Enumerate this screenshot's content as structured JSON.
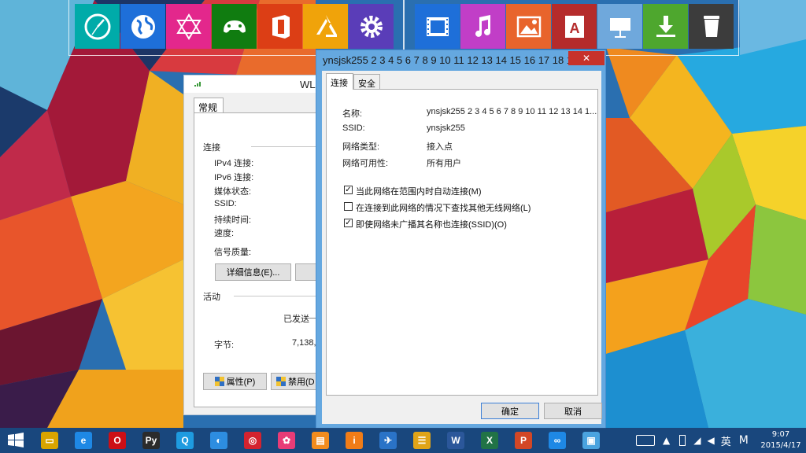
{
  "dock": {
    "left": [
      {
        "name": "clock-icon",
        "color": "#00aba9"
      },
      {
        "name": "globe-icon",
        "color": "#1e6fd9"
      },
      {
        "name": "network-icon",
        "color": "#e3278c"
      },
      {
        "name": "xbox-icon",
        "color": "#107c10"
      },
      {
        "name": "office-icon",
        "color": "#dc3e15"
      },
      {
        "name": "appstore-icon",
        "color": "#f0a30a"
      },
      {
        "name": "settings-icon",
        "color": "#5a3db8"
      }
    ],
    "right": [
      {
        "name": "video-icon",
        "color": "#1e6fd9"
      },
      {
        "name": "music-icon",
        "color": "#c13ec7"
      },
      {
        "name": "photos-icon",
        "color": "#e8642c"
      },
      {
        "name": "reader-icon",
        "color": "#b52b2b"
      },
      {
        "name": "keynote-icon",
        "color": "#6fa8dc"
      },
      {
        "name": "download-icon",
        "color": "#4ea72e"
      },
      {
        "name": "trash-icon",
        "color": "#3c3c3c"
      }
    ]
  },
  "wlan": {
    "title": "WLA",
    "tab": "常规",
    "section_connection": "连接",
    "ipv4": "IPv4 连接:",
    "ipv6": "IPv6 连接:",
    "media_state": "媒体状态:",
    "ssid": "SSID:",
    "duration": "持续时间:",
    "speed": "速度:",
    "signal": "信号质量:",
    "details_btn": "详细信息(E)...",
    "section_activity": "活动",
    "sent": "已发送",
    "bytes": "字节:",
    "bytes_value": "7,138,5",
    "properties_btn": "属性(P)",
    "disable_btn": "禁用(D"
  },
  "ssid_dialog": {
    "title": "ynsjsk255 2 3 4 5 6 7 8 9 10 11 12 13 14 15 16 17 18 19 ...",
    "close": "✕",
    "tab_connection": "连接",
    "tab_security": "安全",
    "name_label": "名称:",
    "name_value": "ynsjsk255 2 3 4 5 6 7 8 9 10 11 12 13 14 1...",
    "ssid_label": "SSID:",
    "ssid_value": "ynsjsk255",
    "type_label": "网络类型:",
    "type_value": "接入点",
    "avail_label": "网络可用性:",
    "avail_value": "所有用户",
    "opt1": "当此网络在范围内时自动连接(M)",
    "opt1_checked": true,
    "opt2": "在连接到此网络的情况下查找其他无线网络(L)",
    "opt2_checked": false,
    "opt3": "即使网络未广播其名称也连接(SSID)(O)",
    "opt3_checked": true,
    "ok": "确定",
    "cancel": "取消"
  },
  "taskbar": {
    "apps": [
      {
        "name": "file-explorer-icon",
        "color": "#d9a400",
        "glyph": "▭"
      },
      {
        "name": "internet-explorer-icon",
        "color": "#1e88e5",
        "glyph": "e"
      },
      {
        "name": "opera-icon",
        "color": "#cc0f16",
        "glyph": "O"
      },
      {
        "name": "python-icon",
        "color": "#2b2b2b",
        "glyph": "Py"
      },
      {
        "name": "qq-icon",
        "color": "#1e9be0",
        "glyph": "Q"
      },
      {
        "name": "bird-app-icon",
        "color": "#2d8de0",
        "glyph": "◐"
      },
      {
        "name": "camera-app-icon",
        "color": "#d4232f",
        "glyph": "◎"
      },
      {
        "name": "flower-app-icon",
        "color": "#e83c77",
        "glyph": "✿"
      },
      {
        "name": "colorful-app-icon",
        "color": "#f28c1e",
        "glyph": "▤"
      },
      {
        "name": "iread-icon",
        "color": "#f07c17",
        "glyph": "i"
      },
      {
        "name": "plane-app-icon",
        "color": "#2a73c7",
        "glyph": "✈"
      },
      {
        "name": "notes-app-icon",
        "color": "#e0a418",
        "glyph": "☰"
      },
      {
        "name": "word-icon",
        "color": "#2b579a",
        "glyph": "W"
      },
      {
        "name": "excel-icon",
        "color": "#217346",
        "glyph": "X"
      },
      {
        "name": "powerpoint-icon",
        "color": "#d24726",
        "glyph": "P"
      },
      {
        "name": "network-share-icon",
        "color": "#1e88e5",
        "glyph": "∞"
      },
      {
        "name": "remote-desktop-icon",
        "color": "#4aa3df",
        "glyph": "▣"
      }
    ],
    "ime_lang": "英",
    "ime_mode": "M",
    "time": "9:07",
    "date": "2015/4/17"
  }
}
